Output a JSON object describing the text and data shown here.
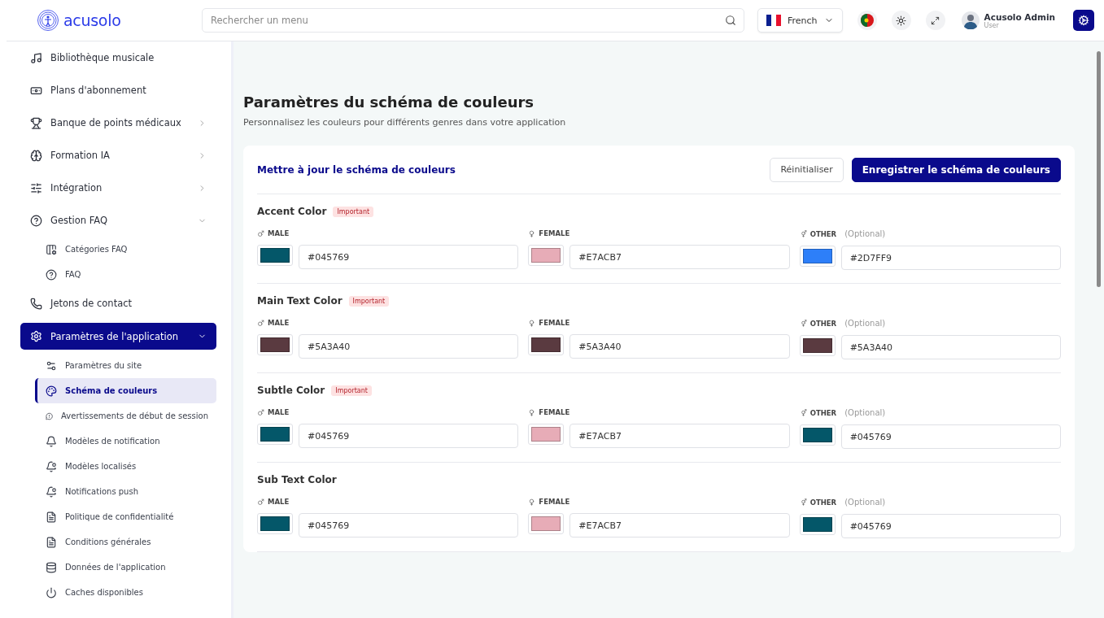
{
  "header": {
    "logo": "acusolo",
    "search": {
      "placeholder": "Rechercher un menu"
    },
    "language": "French",
    "user": {
      "name": "Acusolo Admin",
      "role": "User"
    }
  },
  "sidebar": {
    "items": [
      {
        "label": "Bibliothèque musicale",
        "selected": false
      },
      {
        "label": "Plans d'abonnement",
        "selected": false
      },
      {
        "label": "Banque de points médicaux",
        "selected": false,
        "expanded": false
      },
      {
        "label": "Formation IA",
        "selected": false,
        "expanded": false
      },
      {
        "label": "Intégration",
        "selected": false,
        "expanded": false
      },
      {
        "label": "Gestion FAQ",
        "selected": false,
        "expanded": true,
        "children": [
          {
            "label": "Catégories FAQ",
            "selected": false
          },
          {
            "label": "FAQ",
            "selected": false
          }
        ]
      },
      {
        "label": "Jetons de contact",
        "selected": false
      },
      {
        "label": "Paramètres de l'application",
        "selected": true,
        "expanded": true,
        "children": [
          {
            "label": "Paramètres du site",
            "selected": false
          },
          {
            "label": "Schéma de couleurs",
            "selected": true
          },
          {
            "label": "Avertissements de début de session",
            "selected": false
          },
          {
            "label": "Modèles de notification",
            "selected": false
          },
          {
            "label": "Modèles localisés",
            "selected": false
          },
          {
            "label": "Notifications push",
            "selected": false
          },
          {
            "label": "Politique de confidentialité",
            "selected": false
          },
          {
            "label": "Conditions générales",
            "selected": false
          },
          {
            "label": "Données de l'application",
            "selected": false
          },
          {
            "label": "Caches disponibles",
            "selected": false
          }
        ]
      }
    ]
  },
  "page": {
    "title": "Paramètres du schéma de couleurs",
    "subtitle": "Personnalisez les couleurs pour différents genres dans votre application"
  },
  "card": {
    "title": "Mettre à jour le schéma de couleurs",
    "buttons": [
      {
        "label": "Réinitialiser",
        "kind": "secondary"
      },
      {
        "label": "Enregistrer le schéma de couleurs",
        "kind": "primary"
      }
    ],
    "sections": [
      {
        "title": "Accent Color",
        "badge": "Important",
        "fields": [
          {
            "kind": "male",
            "label": "MALE",
            "color": "#045769",
            "value": "#045769"
          },
          {
            "kind": "female",
            "label": "FEMALE",
            "color": "#e7acb7",
            "value": "#E7ACB7"
          },
          {
            "kind": "other",
            "label": "OTHER",
            "note": "(Optional)",
            "color": "#2d7ff9",
            "value": "#2D7FF9"
          }
        ]
      },
      {
        "title": "Main Text Color",
        "badge": "Important",
        "fields": [
          {
            "kind": "male",
            "label": "MALE",
            "color": "#5a3a40",
            "value": "#5A3A40"
          },
          {
            "kind": "female",
            "label": "FEMALE",
            "color": "#5a3a40",
            "value": "#5A3A40"
          },
          {
            "kind": "other",
            "label": "OTHER",
            "note": "(Optional)",
            "color": "#5a3a40",
            "value": "#5A3A40"
          }
        ]
      },
      {
        "title": "Subtle Color",
        "badge": "Important",
        "fields": [
          {
            "kind": "male",
            "label": "MALE",
            "color": "#045769",
            "value": "#045769"
          },
          {
            "kind": "female",
            "label": "FEMALE",
            "color": "#e7acb7",
            "value": "#E7ACB7"
          },
          {
            "kind": "other",
            "label": "OTHER",
            "note": "(Optional)",
            "color": "#045769",
            "value": "#045769"
          }
        ]
      },
      {
        "title": "Sub Text Color",
        "fields": [
          {
            "kind": "male",
            "label": "MALE",
            "color": "#045769",
            "value": "#045769"
          },
          {
            "kind": "female",
            "label": "FEMALE",
            "color": "#e7acb7",
            "value": "#E7ACB7"
          },
          {
            "kind": "other",
            "label": "OTHER",
            "note": "(Optional)",
            "color": "#045769",
            "value": "#045769"
          }
        ]
      }
    ]
  }
}
